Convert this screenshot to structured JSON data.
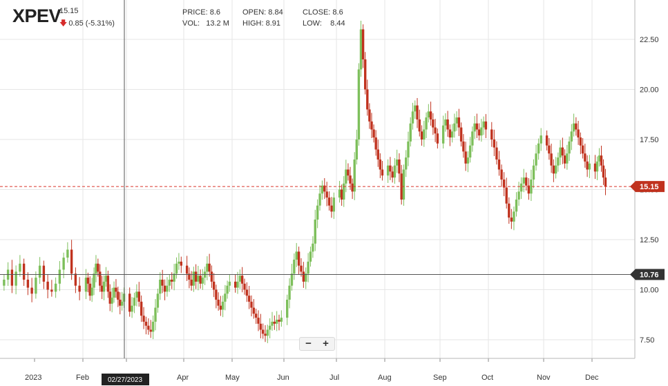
{
  "header": {
    "symbol": "XPEV",
    "last_price": "15.15",
    "change": "0.85 (-5.31%)",
    "change_direction": "down",
    "stats": {
      "price_label": "PRICE:",
      "price": "8.6",
      "open_label": "OPEN:",
      "open": "8.84",
      "close_label": "CLOSE:",
      "close": "8.6",
      "vol_label": "VOL:",
      "vol": "13.2 M",
      "high_label": "HIGH:",
      "high": "8.91",
      "low_label": "LOW:",
      "low": "8.44"
    }
  },
  "zoom": {
    "minus": "−",
    "plus": "+"
  },
  "crosshair": {
    "date_label": "02/27/2023",
    "price_label": "10.76"
  },
  "current_price_label": "15.15",
  "colors": {
    "up": "#7dbf5b",
    "down": "#c0321e",
    "current_line": "#d9342b",
    "badge_current": "#c0321e",
    "badge_crosshair": "#333333"
  },
  "chart_data": {
    "type": "candlestick",
    "ylim": [
      6.5,
      24
    ],
    "y_ticks": [
      "7.50",
      "10.00",
      "12.50",
      "15.00",
      "17.50",
      "20.00",
      "22.50"
    ],
    "x_ticks": [
      "2023",
      "Feb",
      "Mar",
      "Apr",
      "May",
      "Jun",
      "Jul",
      "Aug",
      "Sep",
      "Oct",
      "Nov",
      "Dec"
    ],
    "current_price": 15.15,
    "crosshair_price": 10.76,
    "grid": true,
    "series": [
      {
        "month": "Jan",
        "values": [
          10.5,
          11.0,
          10.2,
          10.9,
          11.3,
          10.5,
          10.1,
          9.8,
          10.6,
          11.2,
          10.4,
          10.0,
          9.9,
          10.3,
          11.0,
          11.6,
          12.0,
          10.8,
          10.2,
          9.9
        ]
      },
      {
        "month": "Feb",
        "values": [
          10.6,
          10.3,
          9.7,
          10.1,
          10.8,
          11.3,
          10.9,
          10.2,
          9.9,
          10.4,
          10.7,
          9.9,
          9.3,
          9.6,
          10.1,
          9.9,
          9.5,
          9.2,
          9.4,
          9.8
        ]
      },
      {
        "month": "Mar",
        "values": [
          8.9,
          9.2,
          9.6,
          9.9,
          9.4,
          8.7,
          8.4,
          8.2,
          8.0,
          7.9,
          8.4,
          9.1,
          9.8,
          10.5,
          10.2,
          9.9,
          10.2,
          10.5,
          10.4,
          10.8,
          11.3,
          11.4,
          11.2
        ]
      },
      {
        "month": "Apr",
        "values": [
          10.8,
          10.5,
          10.2,
          10.9,
          10.4,
          10.7,
          10.3,
          10.6,
          10.9,
          11.3,
          10.9,
          10.4,
          10.0,
          9.5,
          9.2,
          9.0,
          9.4,
          9.8,
          10.2,
          10.4
        ]
      },
      {
        "month": "May",
        "values": [
          10.1,
          10.4,
          10.7,
          10.3,
          10.0,
          9.7,
          9.4,
          9.1,
          8.8,
          8.6,
          8.3,
          8.0,
          7.8,
          7.7,
          8.0,
          8.2,
          8.4,
          8.3,
          8.5,
          8.4,
          8.6
        ]
      },
      {
        "month": "Jun",
        "values": [
          9.5,
          10.2,
          10.8,
          11.5,
          11.9,
          11.2,
          10.9,
          10.4,
          10.8,
          11.4,
          11.9,
          12.3,
          13.5,
          14.2,
          14.8,
          15.2,
          14.9,
          14.6,
          14.2,
          13.9,
          14.6
        ]
      },
      {
        "month": "Jul",
        "values": [
          15.0,
          14.5,
          15.3,
          16.0,
          15.7,
          15.3,
          14.9,
          16.5,
          17.5,
          21.0,
          23.0,
          21.5,
          20.0,
          19.0,
          18.4,
          18.0,
          17.6,
          17.0,
          16.5,
          16.0,
          15.7
        ]
      },
      {
        "month": "Aug",
        "values": [
          16.2,
          15.9,
          15.6,
          16.2,
          16.5,
          15.8,
          14.5,
          16.0,
          16.6,
          17.4,
          18.3,
          18.9,
          19.2,
          18.5,
          17.9,
          17.5,
          18.0,
          18.6,
          18.9,
          18.5,
          18.1,
          17.8,
          17.3
        ]
      },
      {
        "month": "Sep",
        "values": [
          18.2,
          18.5,
          18.0,
          17.6,
          17.9,
          18.3,
          18.6,
          18.1,
          17.4,
          16.9,
          16.3,
          16.6,
          17.2,
          17.9,
          18.3,
          18.0,
          17.7,
          18.1,
          18.4,
          18.0
        ]
      },
      {
        "month": "Oct",
        "values": [
          17.5,
          17.1,
          16.5,
          16.0,
          15.5,
          15.1,
          14.3,
          13.6,
          13.4,
          13.9,
          14.5,
          14.9,
          15.3,
          15.6,
          15.2,
          14.8,
          15.5,
          16.2,
          16.8,
          17.3,
          17.7
        ]
      },
      {
        "month": "Nov",
        "values": [
          17.2,
          16.8,
          16.2,
          15.8,
          16.2,
          16.6,
          17.1,
          16.7,
          16.3,
          16.8,
          17.4,
          17.9,
          18.3,
          18.0,
          17.6,
          17.2,
          16.8,
          16.4,
          16.0,
          16.3
        ]
      },
      {
        "month": "Dec",
        "values": [
          15.9,
          16.4,
          16.7,
          16.2,
          15.6,
          15.15
        ]
      }
    ]
  }
}
